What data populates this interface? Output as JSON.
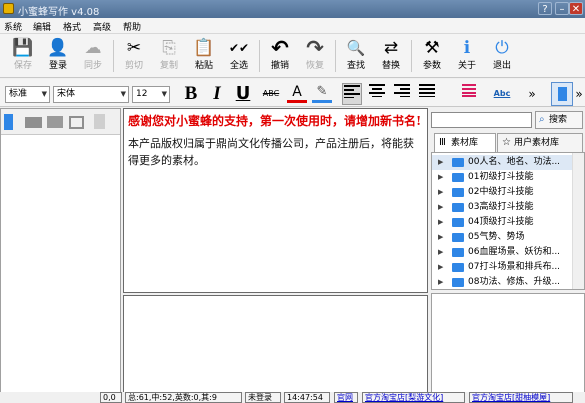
{
  "window": {
    "title": "小蜜蜂写作 v4.08",
    "controls": {
      "help": "?",
      "minimize": "–",
      "close": "✕"
    }
  },
  "menu": [
    "系统",
    "编辑",
    "格式",
    "高级",
    "帮助"
  ],
  "toolbar": [
    {
      "label": "保存",
      "icon": "save-icon",
      "glyph": "💾",
      "enabled": false
    },
    {
      "label": "登录",
      "icon": "user-icon",
      "glyph": "👤",
      "enabled": true
    },
    {
      "label": "同步",
      "icon": "cloud-icon",
      "glyph": "☁",
      "enabled": false
    },
    {
      "label": "剪切",
      "icon": "scissors-icon",
      "glyph": "✂",
      "enabled": false
    },
    {
      "label": "复制",
      "icon": "copy-icon",
      "glyph": "⎘",
      "enabled": false
    },
    {
      "label": "粘贴",
      "icon": "paste-icon",
      "glyph": "📋",
      "enabled": true
    },
    {
      "label": "全选",
      "icon": "select-all-icon",
      "glyph": "✔✔",
      "enabled": true
    },
    {
      "label": "撤销",
      "icon": "undo-icon",
      "glyph": "↶",
      "enabled": true
    },
    {
      "label": "恢复",
      "icon": "redo-icon",
      "glyph": "↷",
      "enabled": false
    },
    {
      "label": "查找",
      "icon": "find-icon",
      "glyph": "🔍",
      "enabled": true
    },
    {
      "label": "替换",
      "icon": "replace-icon",
      "glyph": "⇄",
      "enabled": true
    },
    {
      "label": "参数",
      "icon": "tools-icon",
      "glyph": "⚒",
      "enabled": true
    },
    {
      "label": "关于",
      "icon": "info-icon",
      "glyph": "ℹ",
      "enabled": true
    },
    {
      "label": "退出",
      "icon": "exit-icon",
      "glyph": "⏻",
      "enabled": true
    }
  ],
  "format": {
    "style": "标准",
    "font": "宋体",
    "size": "12",
    "bold": "B",
    "italic": "I",
    "underline": "U",
    "strike": "ABC",
    "font_color": "A",
    "highlight": "✎",
    "spell": "Abc",
    "more": "»",
    "colors": {
      "red": "#e00000",
      "accent": "#2f86e6"
    }
  },
  "left_toolbar_icons": [
    "book-icon",
    "folder-icon",
    "folder-add-icon",
    "frame-icon",
    "trash-icon"
  ],
  "editor": {
    "heading": "感谢您对小蜜蜂的支持，第一次使用时，请增加新书名!",
    "body": "本产品版权归属于鼎尚文化传播公司，产品注册后，将能获得更多的素材。"
  },
  "search": {
    "value": "",
    "button": "搜索"
  },
  "tabs": [
    {
      "label": "素材库",
      "icon": "library-icon",
      "active": true
    },
    {
      "label": "用户素材库",
      "icon": "star-icon",
      "active": false
    }
  ],
  "tree_items": [
    "00人名、地名、功法...",
    "01初级打斗技能",
    "02中级打斗技能",
    "03高级打斗技能",
    "04顶级打斗技能",
    "05气势、势场",
    "06血腥场景、妖彷和...",
    "07打斗场景和排兵布...",
    "08功法、修炼、升级..."
  ],
  "status": [
    {
      "text": "0,0",
      "link": false
    },
    {
      "text": "总:61,中:52,英数:0,其:9",
      "link": false
    },
    {
      "text": "未登录",
      "link": false
    },
    {
      "text": "14:47:54",
      "link": false
    },
    {
      "text": "官网",
      "link": true
    },
    {
      "text": "官方淘宝店[梨游文化]",
      "link": true
    },
    {
      "text": "官方淘宝店[甜柚模屋]",
      "link": true
    }
  ]
}
